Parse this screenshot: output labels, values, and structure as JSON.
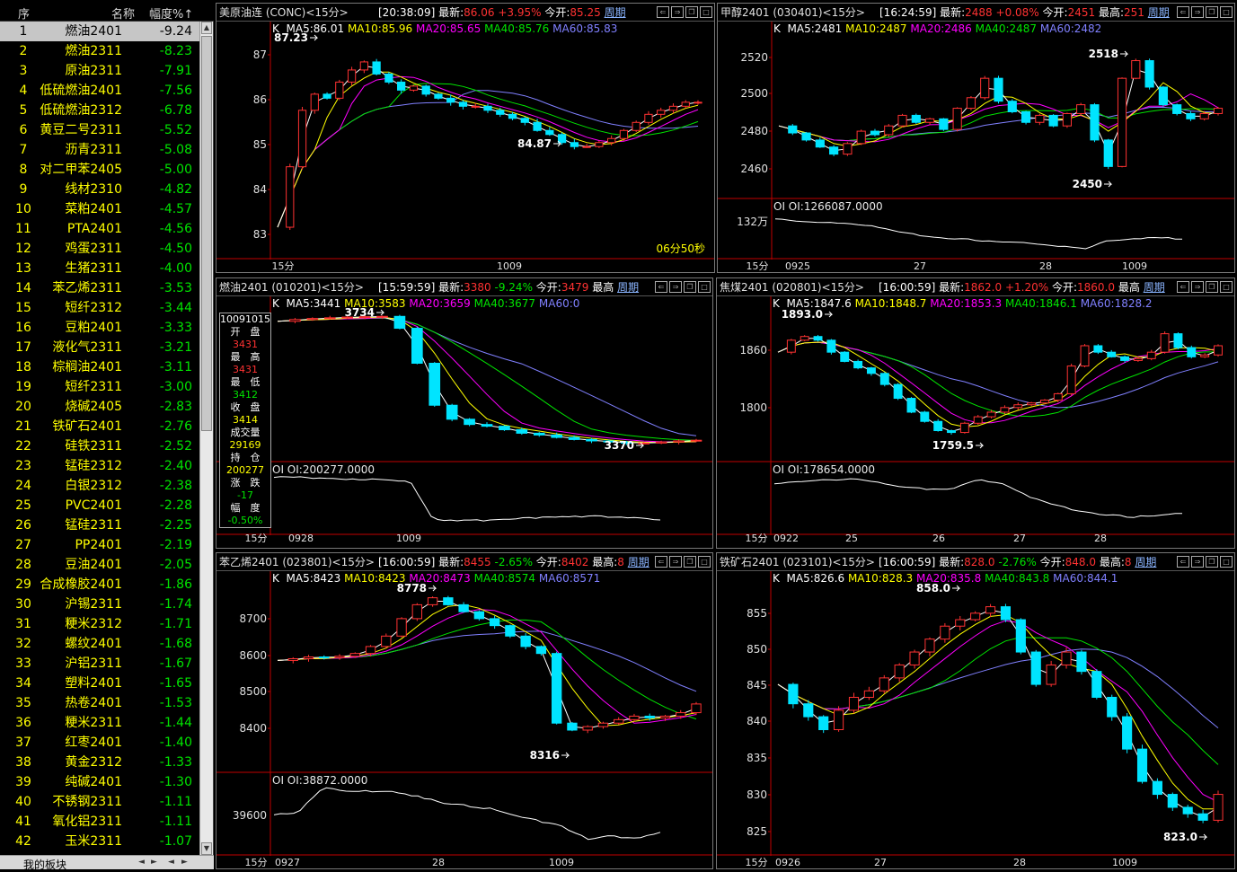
{
  "sidebar": {
    "headers": [
      "序",
      "名称",
      "幅度%↑"
    ],
    "footer": "我的板块",
    "rows": [
      {
        "n": "1",
        "name": "燃油2401",
        "v": "-9.24"
      },
      {
        "n": "2",
        "name": "燃油2311",
        "v": "-8.23"
      },
      {
        "n": "3",
        "name": "原油2311",
        "v": "-7.91"
      },
      {
        "n": "4",
        "name": "低硫燃油2401",
        "v": "-7.56"
      },
      {
        "n": "5",
        "name": "低硫燃油2312",
        "v": "-6.78"
      },
      {
        "n": "6",
        "name": "黄豆二号2311",
        "v": "-5.52"
      },
      {
        "n": "7",
        "name": "沥青2311",
        "v": "-5.08"
      },
      {
        "n": "8",
        "name": "对二甲苯2405",
        "v": "-5.00"
      },
      {
        "n": "9",
        "name": "线材2310",
        "v": "-4.82"
      },
      {
        "n": "10",
        "name": "菜粕2401",
        "v": "-4.57"
      },
      {
        "n": "11",
        "name": "PTA2401",
        "v": "-4.56"
      },
      {
        "n": "12",
        "name": "鸡蛋2311",
        "v": "-4.50"
      },
      {
        "n": "13",
        "name": "生猪2311",
        "v": "-4.00"
      },
      {
        "n": "14",
        "name": "苯乙烯2311",
        "v": "-3.53"
      },
      {
        "n": "15",
        "name": "短纤2312",
        "v": "-3.44"
      },
      {
        "n": "16",
        "name": "豆粕2401",
        "v": "-3.33"
      },
      {
        "n": "17",
        "name": "液化气2311",
        "v": "-3.21"
      },
      {
        "n": "18",
        "name": "棕榈油2401",
        "v": "-3.11"
      },
      {
        "n": "19",
        "name": "短纤2311",
        "v": "-3.00"
      },
      {
        "n": "20",
        "name": "烧碱2405",
        "v": "-2.83"
      },
      {
        "n": "21",
        "name": "铁矿石2401",
        "v": "-2.76"
      },
      {
        "n": "22",
        "name": "硅铁2311",
        "v": "-2.52"
      },
      {
        "n": "23",
        "name": "锰硅2312",
        "v": "-2.40"
      },
      {
        "n": "24",
        "name": "白银2312",
        "v": "-2.38"
      },
      {
        "n": "25",
        "name": "PVC2401",
        "v": "-2.28"
      },
      {
        "n": "26",
        "name": "锰硅2311",
        "v": "-2.25"
      },
      {
        "n": "27",
        "name": "PP2401",
        "v": "-2.19"
      },
      {
        "n": "28",
        "name": "豆油2401",
        "v": "-2.05"
      },
      {
        "n": "29",
        "name": "合成橡胶2401",
        "v": "-1.86"
      },
      {
        "n": "30",
        "name": "沪锡2311",
        "v": "-1.74"
      },
      {
        "n": "31",
        "name": "粳米2312",
        "v": "-1.71"
      },
      {
        "n": "32",
        "name": "螺纹2401",
        "v": "-1.68"
      },
      {
        "n": "33",
        "name": "沪铝2311",
        "v": "-1.67"
      },
      {
        "n": "34",
        "name": "塑料2401",
        "v": "-1.65"
      },
      {
        "n": "35",
        "name": "热卷2401",
        "v": "-1.53"
      },
      {
        "n": "36",
        "name": "粳米2311",
        "v": "-1.44"
      },
      {
        "n": "37",
        "name": "红枣2401",
        "v": "-1.40"
      },
      {
        "n": "38",
        "name": "黄金2312",
        "v": "-1.33"
      },
      {
        "n": "39",
        "name": "纯碱2401",
        "v": "-1.30"
      },
      {
        "n": "40",
        "name": "不锈钢2311",
        "v": "-1.11"
      },
      {
        "n": "41",
        "name": "氧化铝2311",
        "v": "-1.11"
      },
      {
        "n": "42",
        "name": "玉米2311",
        "v": "-1.07"
      }
    ]
  },
  "colors": {
    "up": "#ff3232",
    "down": "#00e4ff",
    "ma5": "#ffffff",
    "ma10": "#ffff00",
    "ma20": "#ff00ff",
    "ma40": "#00e400",
    "ma60": "#8080ff",
    "axis": "#c00000",
    "label": "#ffffff",
    "yellow": "#ffff00",
    "green": "#00e400",
    "red": "#ff3232"
  },
  "panels": [
    {
      "id": "p0",
      "title": "美原油连 (CONC)<15分>",
      "time": "[20:38:09]",
      "latest_label": "最新:",
      "latest": "86.06",
      "pct": "+3.95%",
      "open_label": "今开:",
      "open": "85.25",
      "period": "周期",
      "ma": {
        "k": "K",
        "ma5": "MA5:86.01",
        "ma10": "MA10:85.96",
        "ma20": "MA20:85.65",
        "ma40": "MA40:85.76",
        "ma60": "MA60:85.83"
      },
      "yticks": [
        "87",
        "86",
        "85",
        "84",
        "83"
      ],
      "hi_label": "87.23",
      "lo_label": "84.87",
      "countdown": "06分50秒",
      "xlabels": [
        "15分",
        "1009"
      ],
      "oi": null
    },
    {
      "id": "p1",
      "title": "甲醇2401 (030401)<15分>",
      "time": "[16:24:59]",
      "latest_label": "最新:",
      "latest": "2488",
      "pct": "+0.08%",
      "open_label": "今开:",
      "open": "2451",
      "extra_label": "最高:",
      "extra": "251",
      "period": "周期",
      "ma": {
        "k": "K",
        "ma5": "MA5:2481",
        "ma10": "MA10:2487",
        "ma20": "MA20:2486",
        "ma40": "MA40:2487",
        "ma60": "MA60:2482"
      },
      "yticks": [
        "2520",
        "2500",
        "2480",
        "2460"
      ],
      "hi_label": "2518",
      "lo_label": "2450",
      "oi": {
        "caption": "OI OI:1266087.0000",
        "ytick": "132万"
      },
      "xlabels": [
        "15分",
        "0925",
        "27",
        "28",
        "1009"
      ]
    },
    {
      "id": "p2",
      "title": "燃油2401 (010201)<15分>",
      "time": "[15:59:59]",
      "latest_label": "最新:",
      "latest": "3380",
      "pct": "-9.24%",
      "open_label": "今开:",
      "open": "3479",
      "extra_label": "最高",
      "period": "周期",
      "ma": {
        "k": "K",
        "ma5": "MA5:3441",
        "ma10": "MA10:3583",
        "ma20": "MA20:3659",
        "ma40": "MA40:3677",
        "ma60": "MA60:0"
      },
      "hi_label": "3734",
      "lo_label": "3370",
      "oi": {
        "caption": "OI OI:200277.0000",
        "ytick": ""
      },
      "xlabels": [
        "15分",
        "0928",
        "1009"
      ],
      "info": [
        [
          "10091015",
          "#fff"
        ],
        [
          "开　盘",
          "#fff"
        ],
        [
          "3431",
          "#ff3232"
        ],
        [
          "最　高",
          "#fff"
        ],
        [
          "3431",
          "#ff3232"
        ],
        [
          "最　低",
          "#fff"
        ],
        [
          "3412",
          "#00e400"
        ],
        [
          "收　盘",
          "#fff"
        ],
        [
          "3414",
          "#ffff00"
        ],
        [
          "成交量",
          "#fff"
        ],
        [
          "29169",
          "#ffff00"
        ],
        [
          "持　仓",
          "#fff"
        ],
        [
          "200277",
          "#ffff00"
        ],
        [
          "涨　跌",
          "#fff"
        ],
        [
          "-17",
          "#00e400"
        ],
        [
          "幅　度",
          "#fff"
        ],
        [
          "-0.50%",
          "#00e400"
        ]
      ]
    },
    {
      "id": "p3",
      "title": "焦煤2401 (020801)<15分>",
      "time": "[16:00:59]",
      "latest_label": "最新:",
      "latest": "1862.0",
      "pct": "+1.20%",
      "open_label": "今开:",
      "open": "1860.0",
      "extra_label": "最高",
      "period": "周期",
      "ma": {
        "k": "K",
        "ma5": "MA5:1847.6",
        "ma10": "MA10:1848.7",
        "ma20": "MA20:1853.3",
        "ma40": "MA40:1846.1",
        "ma60": "MA60:1828.2"
      },
      "yticks": [
        "1860",
        "1800"
      ],
      "hi_label": "1893.0",
      "lo_label": "1759.5",
      "oi": {
        "caption": "OI OI:178654.0000",
        "ytick": ""
      },
      "xlabels": [
        "15分",
        "0922",
        "25",
        "26",
        "27",
        "28"
      ]
    },
    {
      "id": "p4",
      "title": "苯乙烯2401 (023801)<15分>",
      "time": "[16:00:59]",
      "latest_label": "最新:",
      "latest": "8455",
      "pct": "-2.65%",
      "open_label": "今开:",
      "open": "8402",
      "extra_label": "最高:",
      "extra": "8",
      "period": "周期",
      "ma": {
        "k": "K",
        "ma5": "MA5:8423",
        "ma10": "MA10:8423",
        "ma20": "MA20:8473",
        "ma40": "MA40:8574",
        "ma60": "MA60:8571"
      },
      "yticks": [
        "8700",
        "8600",
        "8500",
        "8400"
      ],
      "hi_label": "8778",
      "lo_label": "8316",
      "oi": {
        "caption": "OI OI:38872.0000",
        "ytick": "39600"
      },
      "xlabels": [
        "15分",
        "0927",
        "28",
        "1009"
      ]
    },
    {
      "id": "p5",
      "title": "铁矿石2401 (023101)<15分>",
      "time": "[16:00:59]",
      "latest_label": "最新:",
      "latest": "828.0",
      "pct": "-2.76%",
      "open_label": "今开:",
      "open": "848.0",
      "extra_label": "最高:",
      "extra": "8",
      "period": "周期",
      "ma": {
        "k": "K",
        "ma5": "MA5:826.6",
        "ma10": "MA10:828.3",
        "ma20": "MA20:835.8",
        "ma40": "MA40:843.8",
        "ma60": "MA60:844.1"
      },
      "yticks": [
        "855",
        "850",
        "845",
        "840",
        "835",
        "830",
        "825"
      ],
      "hi_label": "858.0",
      "lo_label": "823.0",
      "oi": null,
      "xlabels": [
        "15分",
        "0926",
        "27",
        "28",
        "1009"
      ]
    }
  ]
}
